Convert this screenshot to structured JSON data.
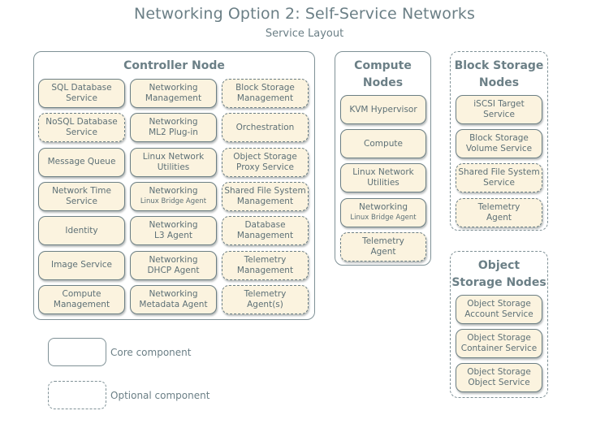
{
  "header": {
    "title": "Networking Option 2: Self-Service Networks",
    "subtitle": "Service Layout"
  },
  "controller": {
    "title": "Controller Node",
    "components": [
      {
        "line1": "SQL Database",
        "line2": "Service",
        "type": "core"
      },
      {
        "line1": "Networking",
        "line2": "Management",
        "type": "core"
      },
      {
        "line1": "Block Storage",
        "line2": "Management",
        "type": "optional"
      },
      {
        "line1": "NoSQL Database",
        "line2": "Service",
        "type": "optional"
      },
      {
        "line1": "Networking",
        "line2": "ML2 Plug-in",
        "type": "core"
      },
      {
        "line1": "Orchestration",
        "line2": "",
        "type": "optional"
      },
      {
        "line1": "Message Queue",
        "line2": "",
        "type": "core"
      },
      {
        "line1": "Linux Network",
        "line2": "Utilities",
        "type": "core"
      },
      {
        "line1": "Object Storage",
        "line2": "Proxy Service",
        "type": "optional"
      },
      {
        "line1": "Network Time",
        "line2": "Service",
        "type": "core"
      },
      {
        "line1": "Networking",
        "line2": "Linux Bridge Agent",
        "type": "core"
      },
      {
        "line1": "Shared File System",
        "line2": "Management",
        "type": "optional"
      },
      {
        "line1": "Identity",
        "line2": "",
        "type": "core"
      },
      {
        "line1": "Networking",
        "line2": "L3 Agent",
        "type": "core"
      },
      {
        "line1": "Database",
        "line2": "Management",
        "type": "optional"
      },
      {
        "line1": "Image Service",
        "line2": "",
        "type": "core"
      },
      {
        "line1": "Networking",
        "line2": "DHCP Agent",
        "type": "core"
      },
      {
        "line1": "Telemetry",
        "line2": "Management",
        "type": "optional"
      },
      {
        "line1": "Compute",
        "line2": "Management",
        "type": "core"
      },
      {
        "line1": "Networking",
        "line2": "Metadata Agent",
        "type": "core"
      },
      {
        "line1": "Telemetry",
        "line2": "Agent(s)",
        "type": "optional"
      }
    ]
  },
  "compute": {
    "title_line1": "Compute",
    "title_line2": "Nodes",
    "components": [
      {
        "line1": "KVM Hypervisor",
        "line2": "",
        "type": "core"
      },
      {
        "line1": "Compute",
        "line2": "",
        "type": "core"
      },
      {
        "line1": "Linux Network",
        "line2": "Utilities",
        "type": "core"
      },
      {
        "line1": "Networking",
        "line2": "Linux Bridge Agent",
        "type": "core"
      },
      {
        "line1": "Telemetry",
        "line2": "Agent",
        "type": "optional"
      }
    ]
  },
  "block_storage": {
    "title_line1": "Block Storage",
    "title_line2": "Nodes",
    "components": [
      {
        "line1": "iSCSI Target",
        "line2": "Service",
        "type": "core"
      },
      {
        "line1": "Block Storage",
        "line2": "Volume Service",
        "type": "core"
      },
      {
        "line1": "Shared File System",
        "line2": "Service",
        "type": "optional"
      },
      {
        "line1": "Telemetry",
        "line2": "Agent",
        "type": "optional"
      }
    ]
  },
  "object_storage": {
    "title_line1": "Object",
    "title_line2": "Storage Nodes",
    "components": [
      {
        "line1": "Object Storage",
        "line2": "Account Service",
        "type": "core"
      },
      {
        "line1": "Object Storage",
        "line2": "Container Service",
        "type": "core"
      },
      {
        "line1": "Object Storage",
        "line2": "Object Service",
        "type": "core"
      }
    ]
  },
  "legend": {
    "core_label": "Core component",
    "optional_label": "Optional component"
  },
  "colors": {
    "component_fill": "#fbf3df",
    "border": "#6c7f84",
    "text": "#6b7f86"
  }
}
